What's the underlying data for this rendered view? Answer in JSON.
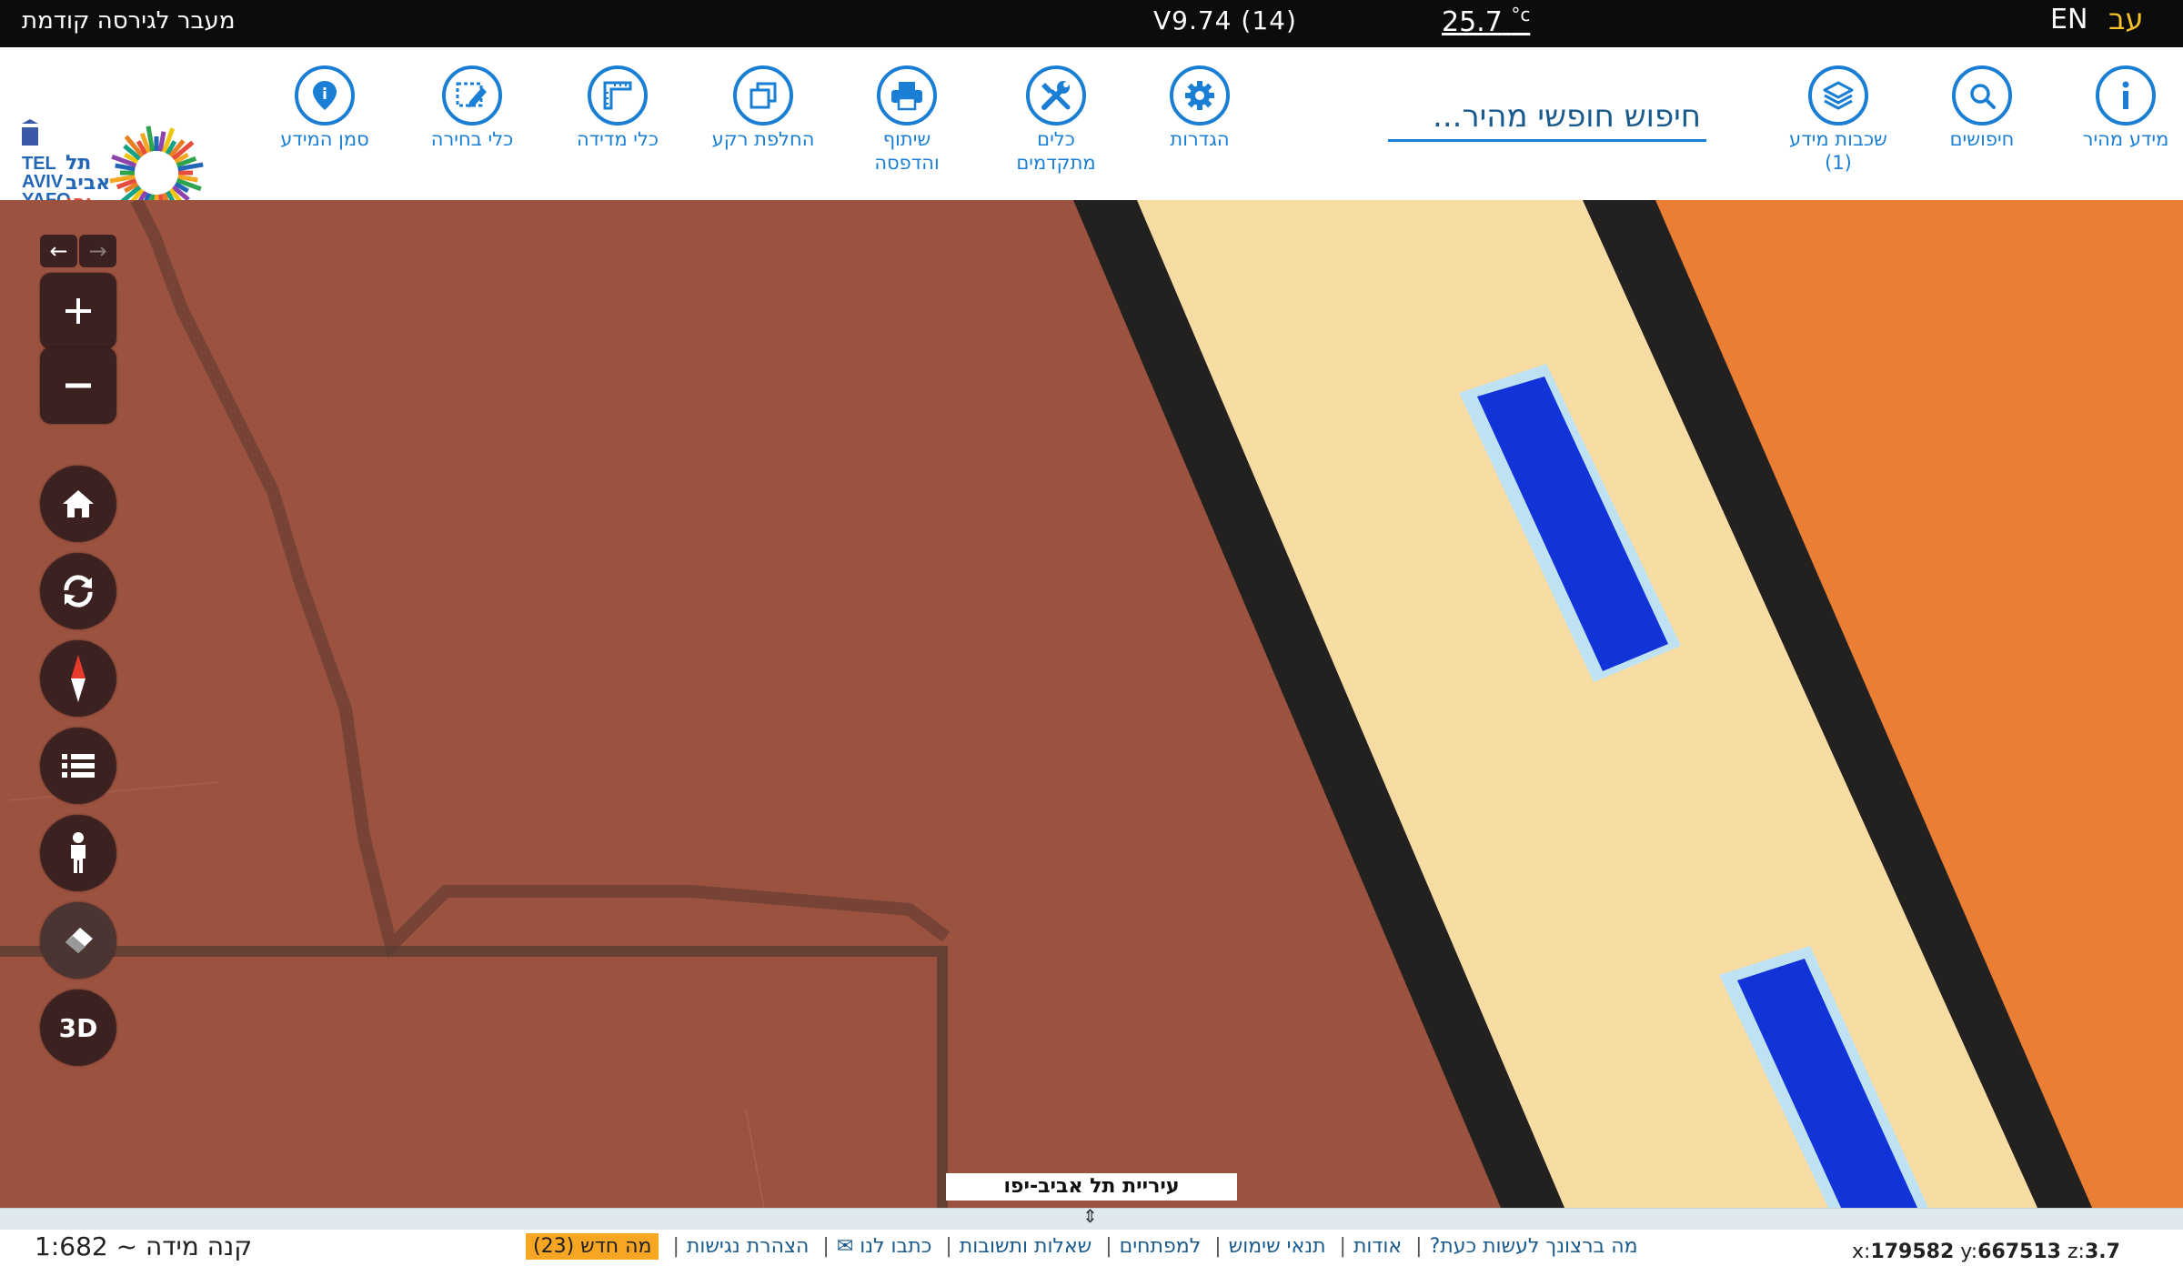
{
  "topbar": {
    "prev_version": "מעבר לגירסה קודמת",
    "version": "V9.74 (14)",
    "temperature": "25.7",
    "temp_unit": "°c",
    "lang_en": "EN",
    "lang_he": "עב"
  },
  "toolbar": {
    "search_placeholder": "חיפוש חופשי מהיר...",
    "items": [
      {
        "label": "מידע מהיר",
        "icon": "info-icon"
      },
      {
        "label": "חיפושים",
        "icon": "search-icon"
      },
      {
        "label": "שכבות מידע",
        "sub": "(1)",
        "icon": "layers-icon"
      },
      {
        "label": "הגדרות",
        "icon": "gear-icon"
      },
      {
        "label": "כלים",
        "sub": "מתקדמים",
        "icon": "tools-icon"
      },
      {
        "label": "שיתוף",
        "sub": "והדפסה",
        "icon": "printer-icon"
      },
      {
        "label": "החלפת רקע",
        "icon": "basemap-icon"
      },
      {
        "label": "כלי מדידה",
        "icon": "ruler-icon"
      },
      {
        "label": "כלי בחירה",
        "icon": "select-icon"
      },
      {
        "label": "סמן המידע",
        "icon": "marker-icon"
      }
    ],
    "logo": {
      "text_en_1": "TEL",
      "text_en_2": "AVIV",
      "text_en_3": "YAFO",
      "text_he_1": "תל",
      "text_he_2": "אביב",
      "text_he_3": "יפו"
    }
  },
  "map": {
    "attribution": "עיריית תל אביב-יפו",
    "controls": [
      "back-arrow",
      "forward-arrow",
      "zoom-in",
      "zoom-out",
      "home",
      "refresh",
      "compass",
      "legend",
      "street-view",
      "eraser",
      "3d"
    ],
    "label_3d": "3D",
    "colors": {
      "land": "#9b523f",
      "road": "#f7dca4",
      "water": "#1233d8",
      "orange": "#ea7e35",
      "edge": "#222222"
    }
  },
  "footer": {
    "scale_label": "קנה מידה ~ 1:682",
    "links": [
      "מה ברצונך לעשות כעת?",
      "אודות",
      "תנאי שימוש",
      "למפתחים",
      "שאלות ותשובות",
      "כתבו לנו ✉",
      "הצהרת נגישות"
    ],
    "whats_new": "מה חדש (23)",
    "coord_x_label": "x:",
    "coord_x": "179582",
    "coord_y_label": "y:",
    "coord_y": "667513",
    "coord_z_label": "z:",
    "coord_z": "3.7"
  }
}
